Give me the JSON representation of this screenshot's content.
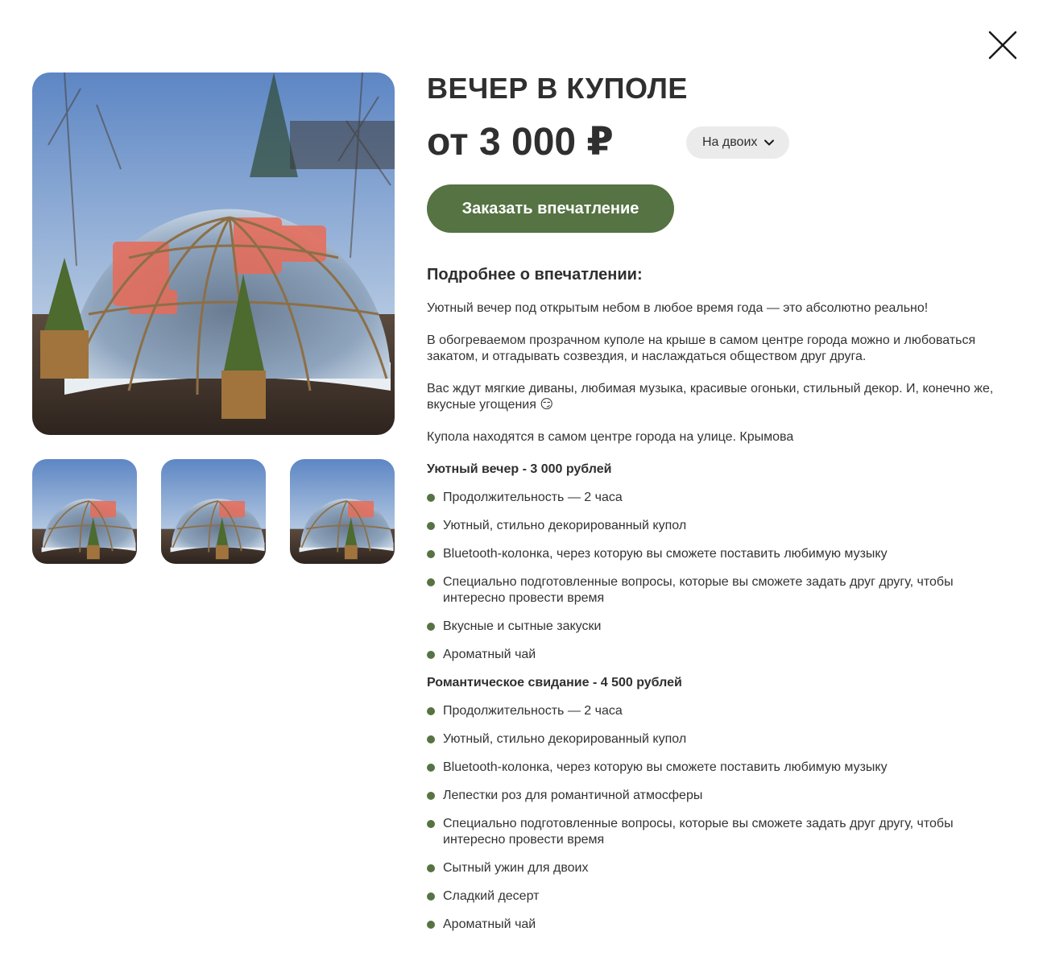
{
  "colors": {
    "accent": "#567343",
    "text": "#2f2f2f",
    "select_bg": "#ebebeb"
  },
  "icons": {
    "close": "close-icon",
    "select": "chevron-down-icon",
    "emoji": "relieved-face-emoji"
  },
  "product": {
    "title": "ВЕЧЕР В КУПОЛЕ",
    "price": "от 3 000 ₽",
    "option_selected": "На двоих",
    "order_label": "Заказать впечатление"
  },
  "details": {
    "heading": "Подробнее о впечатлении:",
    "paragraphs": [
      "Уютный вечер под открытым небом в любое время года — это абсолютно реально!",
      "В обогреваемом прозрачном куполе на крыше в самом центре города можно и любоваться закатом, и отгадывать созвездия, и наслаждаться обществом друг друга.",
      "Вас ждут мягкие диваны, любимая музыка, красивые огоньки, стильный декор. И, конечно же, вкусные угощения 😏",
      "Купола находятся в самом центре города на улице. Крымова"
    ],
    "packages": [
      {
        "title": "Уютный вечер - 3 000 рублей",
        "features": [
          "Продолжительность — 2 часа",
          "Уютный, стильно декорированный купол",
          "Bluetooth-колонка, через которую вы сможете поставить любимую музыку",
          "Специально подготовленные вопросы, которые вы сможете задать друг другу, чтобы интересно провести время",
          "Вкусные и сытные закуски",
          "Ароматный чай"
        ]
      },
      {
        "title": "Романтическое свидание - 4 500 рублей",
        "features": [
          "Продолжительность — 2 часа",
          "Уютный, стильно декорированный купол",
          "Bluetooth-колонка, через которую вы сможете поставить любимую музыку",
          "Лепестки роз для романтичной атмосферы",
          "Специально подготовленные вопросы, которые вы сможете задать друг другу, чтобы интересно провести время",
          "Сытный ужин для двоих",
          "Сладкий десерт",
          "Ароматный чай"
        ]
      }
    ]
  }
}
